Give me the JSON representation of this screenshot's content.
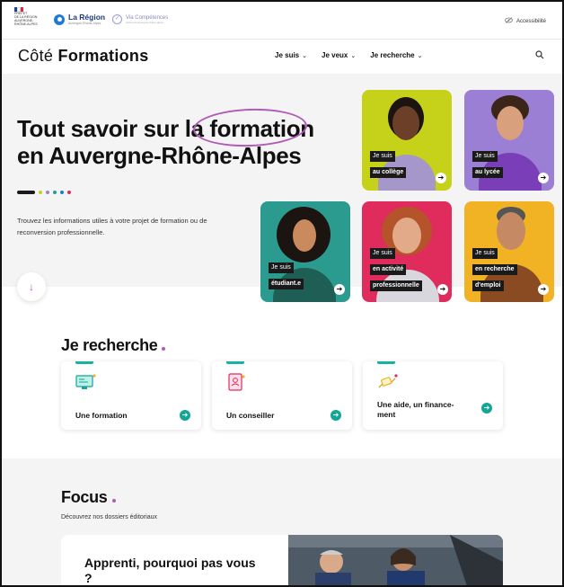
{
  "topbar": {
    "republic_lines": [
      "PRÉFET",
      "DE LA RÉGION",
      "AUVERGNE-",
      "RHÔNE-ALPES"
    ],
    "region_name": "La Région",
    "region_tagline": "Auvergne-Rhône-Alpes",
    "via_name": "Via Compétences",
    "via_tagline": "carif-oref auvergne-rhône-alpes",
    "accessibility_label": "Accessibilité",
    "accessibility_icon": "eye-slash-icon"
  },
  "nav": {
    "logo_part1": "Côté ",
    "logo_part2": "Formations",
    "items": [
      {
        "label": "Je suis"
      },
      {
        "label": "Je veux"
      },
      {
        "label": "Je recherche"
      }
    ],
    "chevron_glyph": "⌄",
    "search_icon": "search-icon"
  },
  "hero": {
    "title_line1_pre": "Tout savoir sur la ",
    "title_highlight": "formation",
    "title_line2": "en Auvergne-Rhône-Alpes",
    "description": "Trouvez les informations utiles à votre projet de formation ou de reconversion professionnelle.",
    "down_icon": "arrow-down-icon",
    "dot_colors": [
      "#1a1a1a",
      "#c6d11a",
      "#9b7fd4",
      "#13a596",
      "#1f7ad6",
      "#e02b5d"
    ]
  },
  "profiles": [
    {
      "line1": "Je suis",
      "line2": "au collège",
      "bg": "#c6d11a"
    },
    {
      "line1": "Je suis",
      "line2": "au lycée",
      "bg": "#9b7fd4"
    },
    {
      "line1": "Je suis",
      "line2": "étudiant.e",
      "bg": "#2a9b8e"
    },
    {
      "line1": "Je suis",
      "line2": "en activité",
      "line3": "professionnelle",
      "bg": "#e02b5d"
    },
    {
      "line1": "Je suis",
      "line2": "en recherche",
      "line3": "d'emploi",
      "bg": "#f1b324"
    }
  ],
  "je_recherche": {
    "title": "Je recherche",
    "cards": [
      {
        "label": "Une formation",
        "icon": "computer-training-icon"
      },
      {
        "label": "Un conseiller",
        "icon": "advisor-notebook-icon"
      },
      {
        "label": "Une aide, un finance-ment",
        "icon": "financing-hand-icon"
      }
    ]
  },
  "focus": {
    "title": "Focus",
    "subtitle": "Découvrez nos dossiers éditoriaux",
    "card_title": "Apprenti, pourquoi pas vous ?"
  },
  "colors": {
    "accent_purple": "#b15ab8",
    "teal": "#13a596",
    "hero_bg": "#f5f4f4"
  }
}
